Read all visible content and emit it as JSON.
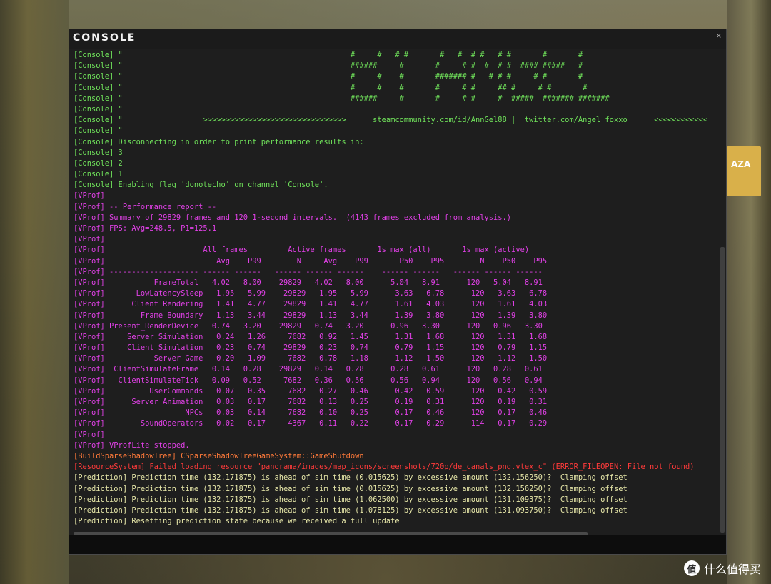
{
  "window": {
    "title": "CONSOLE",
    "close_glyph": "×"
  },
  "colors": {
    "console": "#6fe05a",
    "vprof": "#e040e6",
    "build": "#ff7a3a",
    "resource": "#ff3a3a",
    "prediction": "#e6e6a8"
  },
  "input": {
    "placeholder": ""
  },
  "watermark": {
    "text": "什么值得买",
    "icon": "值"
  },
  "background": {
    "sign_text": "AZA"
  },
  "log_lines": [
    {
      "tag": "console",
      "text": "[Console] \"                                                   #     #   # #       #   #  # #   # #       #       #"
    },
    {
      "tag": "console",
      "text": "[Console] \"                                                   ######     #       #     # #  #  # #  #### #####   #"
    },
    {
      "tag": "console",
      "text": "[Console] \"                                                   #     #    #       ####### #   # # #     # #       #"
    },
    {
      "tag": "console",
      "text": "[Console] \"                                                   #     #    #       #     # #     ## #     # #       #"
    },
    {
      "tag": "console",
      "text": "[Console] \"                                                   ######     #       #     # #     #  #####  ####### #######"
    },
    {
      "tag": "console",
      "text": "[Console] \""
    },
    {
      "tag": "console",
      "text": "[Console] \"                  >>>>>>>>>>>>>>>>>>>>>>>>>>>>>>>>      steamcommunity.com/id/AnnGel88 || twitter.com/Angel_foxxo      <<<<<<<<<<<<"
    },
    {
      "tag": "console",
      "text": "[Console] \""
    },
    {
      "tag": "console",
      "text": "[Console] Disconnecting in order to print performance results in:"
    },
    {
      "tag": "console",
      "text": "[Console] 3"
    },
    {
      "tag": "console",
      "text": "[Console] 2"
    },
    {
      "tag": "console",
      "text": "[Console] 1"
    },
    {
      "tag": "console",
      "text": "[Console] Enabling flag 'donotecho' on channel 'Console'."
    },
    {
      "tag": "vprof",
      "text": "[VProf]"
    },
    {
      "tag": "vprof",
      "text": "[VProf] -- Performance report --"
    },
    {
      "tag": "vprof",
      "text": "[VProf] Summary of 29829 frames and 120 1-second intervals.  (4143 frames excluded from analysis.)"
    },
    {
      "tag": "vprof",
      "text": "[VProf] FPS: Avg=248.5, P1=125.1"
    },
    {
      "tag": "vprof",
      "text": "[VProf]"
    },
    {
      "tag": "vprof",
      "text": "[VProf]                      All frames         Active frames       1s max (all)       1s max (active)"
    },
    {
      "tag": "vprof",
      "text": "[VProf]                         Avg    P99        N     Avg    P99       P50    P95        N    P50    P95"
    },
    {
      "tag": "vprof",
      "text": "[VProf] -------------------- ------ ------   ------ ------ ------    ------ ------   ------ ------ ------"
    },
    {
      "tag": "vprof",
      "text": "[VProf]           FrameTotal   4.02   8.00    29829   4.02   8.00      5.04   8.91      120   5.04   8.91"
    },
    {
      "tag": "vprof",
      "text": "[VProf]       LowLatencySleep   1.95   5.99    29829   1.95   5.99      3.63   6.78      120   3.63   6.78"
    },
    {
      "tag": "vprof",
      "text": "[VProf]      Client Rendering   1.41   4.77    29829   1.41   4.77      1.61   4.03      120   1.61   4.03"
    },
    {
      "tag": "vprof",
      "text": "[VProf]        Frame Boundary   1.13   3.44    29829   1.13   3.44      1.39   3.80      120   1.39   3.80"
    },
    {
      "tag": "vprof",
      "text": "[VProf] Present_RenderDevice   0.74   3.20    29829   0.74   3.20      0.96   3.30      120   0.96   3.30"
    },
    {
      "tag": "vprof",
      "text": "[VProf]     Server Simulation   0.24   1.26     7682   0.92   1.45      1.31   1.68      120   1.31   1.68"
    },
    {
      "tag": "vprof",
      "text": "[VProf]     Client Simulation   0.23   0.74    29829   0.23   0.74      0.79   1.15      120   0.79   1.15"
    },
    {
      "tag": "vprof",
      "text": "[VProf]           Server Game   0.20   1.09     7682   0.78   1.18      1.12   1.50      120   1.12   1.50"
    },
    {
      "tag": "vprof",
      "text": "[VProf]  ClientSimulateFrame   0.14   0.28    29829   0.14   0.28      0.28   0.61      120   0.28   0.61"
    },
    {
      "tag": "vprof",
      "text": "[VProf]   ClientSimulateTick   0.09   0.52     7682   0.36   0.56      0.56   0.94      120   0.56   0.94"
    },
    {
      "tag": "vprof",
      "text": "[VProf]          UserCommands   0.07   0.35     7682   0.27   0.46      0.42   0.59      120   0.42   0.59"
    },
    {
      "tag": "vprof",
      "text": "[VProf]      Server Animation   0.03   0.17     7682   0.13   0.25      0.19   0.31      120   0.19   0.31"
    },
    {
      "tag": "vprof",
      "text": "[VProf]                  NPCs   0.03   0.14     7682   0.10   0.25      0.17   0.46      120   0.17   0.46"
    },
    {
      "tag": "vprof",
      "text": "[VProf]        SoundOperators   0.02   0.17     4367   0.11   0.22      0.17   0.29      114   0.17   0.29"
    },
    {
      "tag": "vprof",
      "text": "[VProf]"
    },
    {
      "tag": "vprof",
      "text": "[VProf] VProfLite stopped."
    },
    {
      "tag": "build",
      "text": "[BuildSparseShadowTree] CSparseShadowTreeGameSystem::GameShutdown"
    },
    {
      "tag": "resource",
      "text": "[ResourceSystem] Failed loading resource \"panorama/images/map_icons/screenshots/720p/de_canals_png.vtex_c\" (ERROR_FILEOPEN: File not found)"
    },
    {
      "tag": "prediction",
      "text": "[Prediction] Prediction time (132.171875) is ahead of sim time (0.015625) by excessive amount (132.156250)?  Clamping offset"
    },
    {
      "tag": "prediction",
      "text": "[Prediction] Prediction time (132.171875) is ahead of sim time (0.015625) by excessive amount (132.156250)?  Clamping offset"
    },
    {
      "tag": "prediction",
      "text": "[Prediction] Prediction time (132.171875) is ahead of sim time (1.062500) by excessive amount (131.109375)?  Clamping offset"
    },
    {
      "tag": "prediction",
      "text": "[Prediction] Prediction time (132.171875) is ahead of sim time (1.078125) by excessive amount (131.093750)?  Clamping offset"
    },
    {
      "tag": "prediction",
      "text": "[Prediction] Resetting prediction state because we received a full update"
    }
  ]
}
